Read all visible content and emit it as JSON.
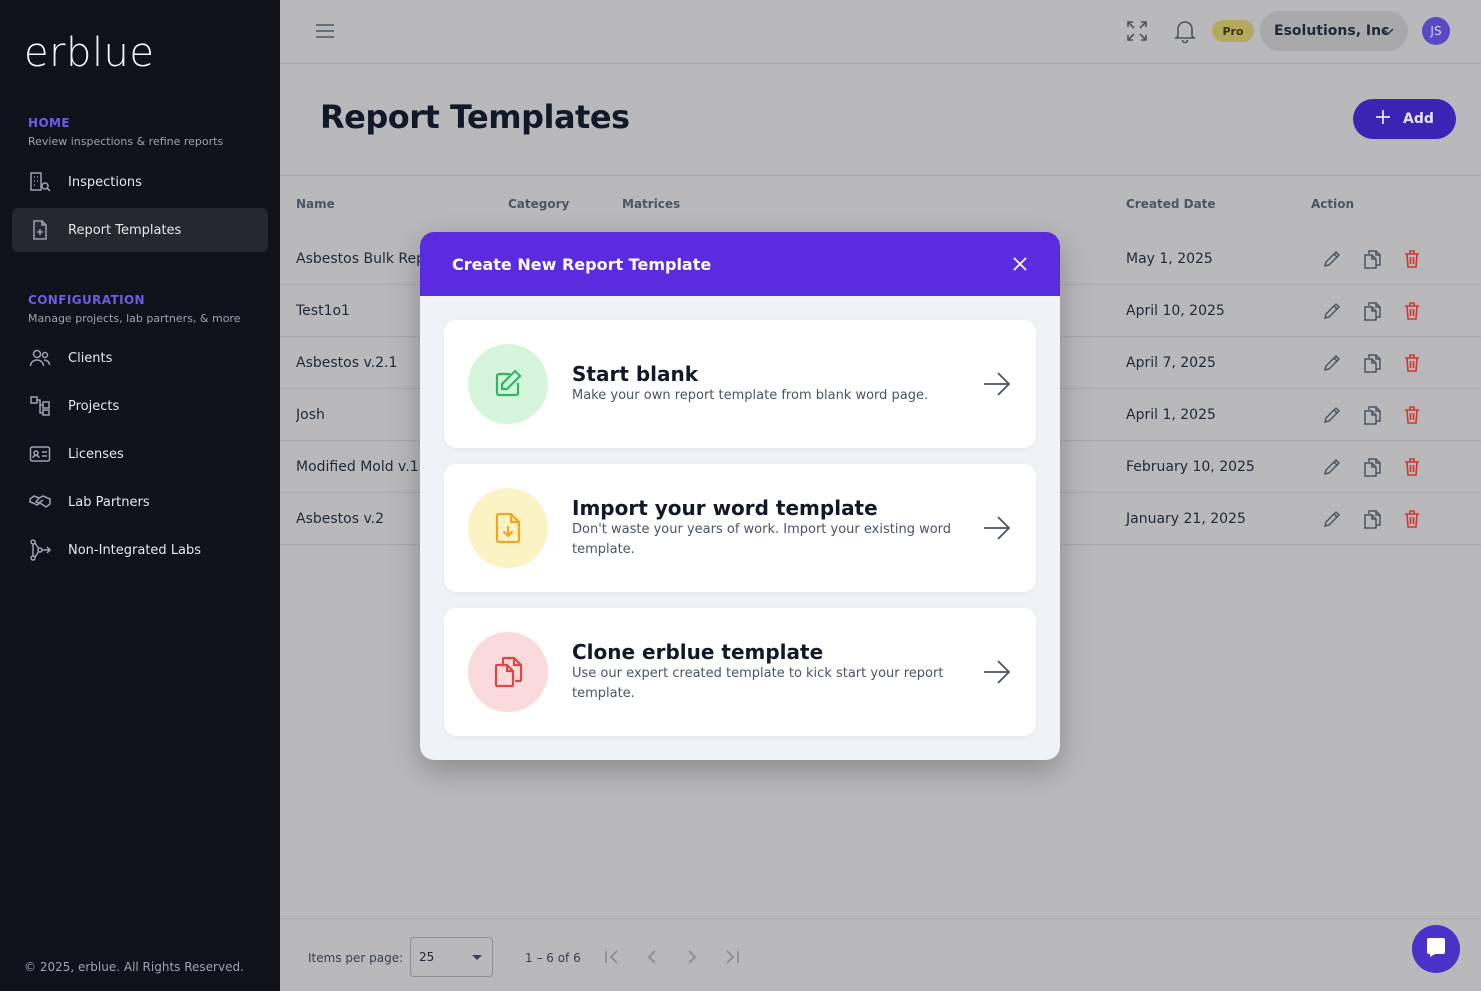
{
  "app": {
    "logo": "erblue",
    "copyright": "© 2025, erblue. All Rights Reserved."
  },
  "sidebar": {
    "home_title": "HOME",
    "home_sub": "Review inspections & refine reports",
    "config_title": "CONFIGURATION",
    "config_sub": "Manage projects, lab partners, & more",
    "items": [
      {
        "label": "Inspections",
        "icon": "building-search-icon"
      },
      {
        "label": "Report Templates",
        "icon": "file-plus-icon",
        "active": true
      },
      {
        "label": "Clients",
        "icon": "users-icon"
      },
      {
        "label": "Projects",
        "icon": "hierarchy-icon"
      },
      {
        "label": "Licenses",
        "icon": "id-card-icon"
      },
      {
        "label": "Lab Partners",
        "icon": "handshake-icon"
      },
      {
        "label": "Non-Integrated Labs",
        "icon": "branch-icon"
      }
    ]
  },
  "topbar": {
    "badge": "Pro",
    "org": "Esolutions, Inc",
    "avatar": "JS"
  },
  "page": {
    "title": "Report Templates",
    "add_label": "Add"
  },
  "table": {
    "headers": {
      "name": "Name",
      "category": "Category",
      "matrices": "Matrices",
      "created": "Created Date",
      "action": "Action"
    },
    "rows": [
      {
        "name": "Asbestos Bulk Report",
        "date": "May 1, 2025"
      },
      {
        "name": "Test1o1",
        "date": "April 10, 2025"
      },
      {
        "name": "Asbestos v.2.1",
        "date": "April 7, 2025"
      },
      {
        "name": "Josh",
        "date": "April 1, 2025"
      },
      {
        "name": "Modified Mold v.1",
        "date": "February 10, 2025"
      },
      {
        "name": "Asbestos v.2",
        "date": "January 21, 2025"
      }
    ]
  },
  "footer": {
    "items_per_page_label": "Items per page:",
    "items_per_page": "25",
    "range": "1 – 6 of 6"
  },
  "modal": {
    "title": "Create New Report Template",
    "options": [
      {
        "title": "Start blank",
        "desc": "Make your own report template from blank word page."
      },
      {
        "title": "Import your word template",
        "desc": "Don't waste your years of work. Import your existing word template."
      },
      {
        "title": "Clone erblue template",
        "desc": "Use our expert created template to kick start your report template."
      }
    ]
  },
  "colors": {
    "accent": "#5b2be0",
    "sidebar": "#11111b",
    "danger": "#d9332f"
  }
}
